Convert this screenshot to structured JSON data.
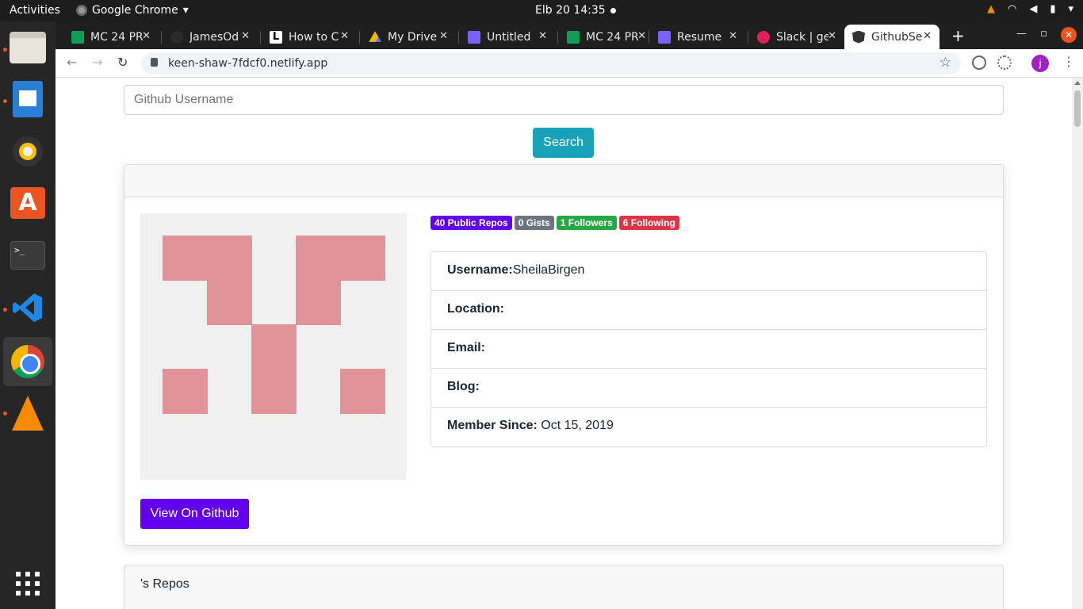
{
  "system": {
    "activities": "Activities",
    "app_name": "Google Chrome",
    "clock": "Elb 20  14:35"
  },
  "browser": {
    "tabs": [
      {
        "label": "MC 24 PR",
        "favicon_color": "#0f9d58"
      },
      {
        "label": "JamesOd",
        "favicon_color": "#1f1f1f"
      },
      {
        "label": "How to C",
        "favicon_color": "#ffffff"
      },
      {
        "label": "My Drive",
        "favicon_color": "#f4b400"
      },
      {
        "label": "Untitled",
        "favicon_color": "#7b61ff"
      },
      {
        "label": "MC 24 PR",
        "favicon_color": "#0f9d58"
      },
      {
        "label": "Resume",
        "favicon_color": "#7b61ff"
      },
      {
        "label": "Slack | ge",
        "favicon_color": "#e01e5a"
      },
      {
        "label": "GithubSe",
        "favicon_color": "#333333"
      }
    ],
    "url": "keen-shaw-7fdcf0.netlify.app",
    "profile_initial": "j"
  },
  "search": {
    "placeholder": "Github Username",
    "button_label": "Search"
  },
  "profile": {
    "badges": [
      {
        "label": "40 Public Repos",
        "color": "#6200ee"
      },
      {
        "label": "0 Gists",
        "color": "#6c757d"
      },
      {
        "label": "1 Followers",
        "color": "#28a745"
      },
      {
        "label": "6 Following",
        "color": "#dc3545"
      }
    ],
    "fields": [
      {
        "label": "Username:",
        "value": "SheilaBirgen"
      },
      {
        "label": "Location:",
        "value": ""
      },
      {
        "label": "Email:",
        "value": ""
      },
      {
        "label": "Blog:",
        "value": ""
      },
      {
        "label": "Member Since:",
        "value": " Oct 15, 2019"
      }
    ],
    "view_button": "View On Github",
    "avatar_color": "#e29399"
  },
  "repos": {
    "title": "'s Repos"
  }
}
